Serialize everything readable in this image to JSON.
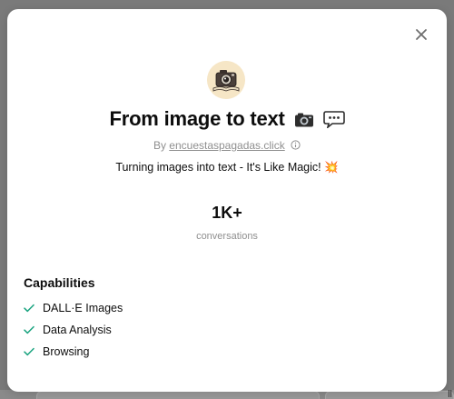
{
  "gpt": {
    "title": "From image to text",
    "title_emoji_icons": [
      "camera-icon",
      "speech-bubble-icon"
    ],
    "author_prefix": "By",
    "author_link": "encuestaspagadas.click",
    "description": "Turning images into text - It's Like Magic! 💥"
  },
  "stats": {
    "value": "1K+",
    "label": "conversations"
  },
  "capabilities": {
    "heading": "Capabilities",
    "items": [
      {
        "label": "DALL·E Images",
        "icon": "check-icon"
      },
      {
        "label": "Data Analysis",
        "icon": "check-icon"
      },
      {
        "label": "Browsing",
        "icon": "check-icon"
      }
    ]
  },
  "background": {
    "partial_glyph": "ll"
  },
  "colors": {
    "check_green": "#19a37f",
    "muted_text": "#8f8f8f",
    "text": "#0d0d0d",
    "overlay": "#7a7a7a"
  }
}
